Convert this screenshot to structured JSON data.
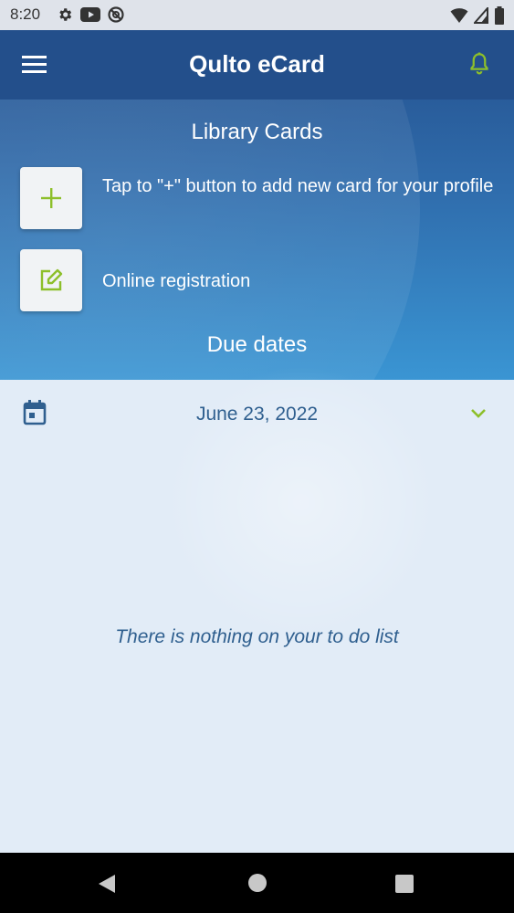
{
  "status_bar": {
    "time": "8:20",
    "left_icons": [
      "gear-icon",
      "youtube-icon",
      "do-not-disturb-icon"
    ],
    "right_icons": [
      "wifi-icon",
      "cell-signal-icon",
      "battery-icon"
    ]
  },
  "app_bar": {
    "title": "Qulto eCard",
    "menu_icon": "hamburger-menu-icon",
    "notification_icon": "bell-icon"
  },
  "library": {
    "title": "Library Cards",
    "add_card_text": "Tap to \"+\" button to add new card for your profile",
    "add_card_icon": "plus-icon",
    "registration_text": "Online registration",
    "registration_icon": "edit-icon"
  },
  "due": {
    "title": "Due dates",
    "date": "June 23, 2022",
    "calendar_icon": "calendar-icon",
    "expand_icon": "chevron-down-icon",
    "empty_message": "There is nothing on your to do list"
  },
  "colors": {
    "accent": "#8dbf2a",
    "header_blue": "#234f8b",
    "text_blue": "#2f5f8f"
  },
  "nav_bar": {
    "buttons": [
      "back-icon",
      "home-icon",
      "recents-icon"
    ]
  }
}
